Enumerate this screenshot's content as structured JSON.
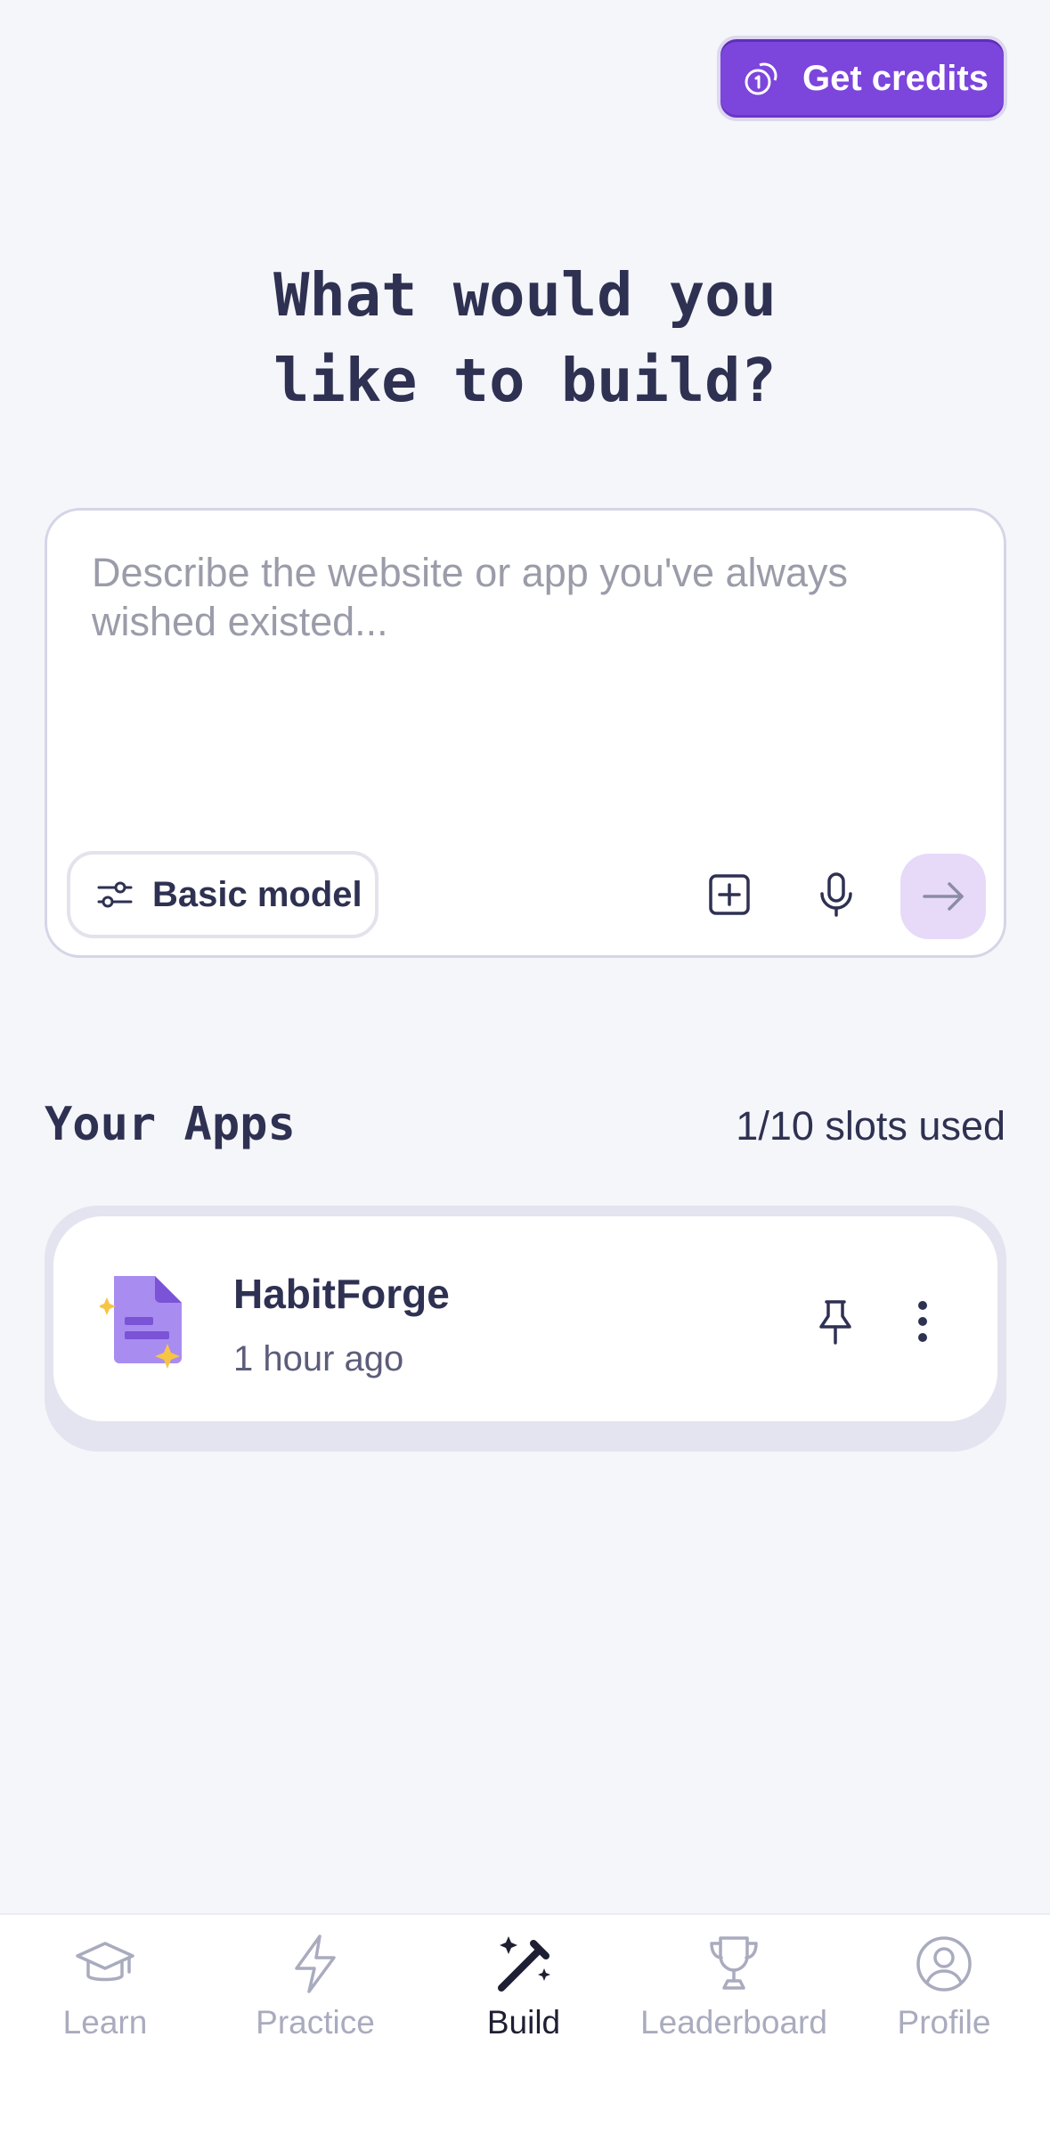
{
  "header": {
    "credits_label": "Get credits",
    "credits_icon": "coin-icon",
    "accent_color": "#7c45dc"
  },
  "main": {
    "title_line1": "What would you",
    "title_line2": "like to build?"
  },
  "prompt": {
    "placeholder": "Describe the website or app you've always wished existed...",
    "model_label": "Basic model",
    "model_icon": "sliders-icon",
    "add_icon": "plus-square-icon",
    "mic_icon": "microphone-icon",
    "send_icon": "arrow-right-icon"
  },
  "apps": {
    "title": "Your Apps",
    "slots": "1/10 slots used",
    "items": [
      {
        "name": "HabitForge",
        "time": "1 hour ago",
        "icon": "document-sparkle-icon"
      }
    ]
  },
  "nav": {
    "items": [
      {
        "label": "Learn",
        "icon": "graduation-cap-icon",
        "active": false
      },
      {
        "label": "Practice",
        "icon": "lightning-icon",
        "active": false
      },
      {
        "label": "Build",
        "icon": "magic-wand-icon",
        "active": true
      },
      {
        "label": "Leaderboard",
        "icon": "trophy-icon",
        "active": false
      },
      {
        "label": "Profile",
        "icon": "user-circle-icon",
        "active": false
      }
    ]
  }
}
